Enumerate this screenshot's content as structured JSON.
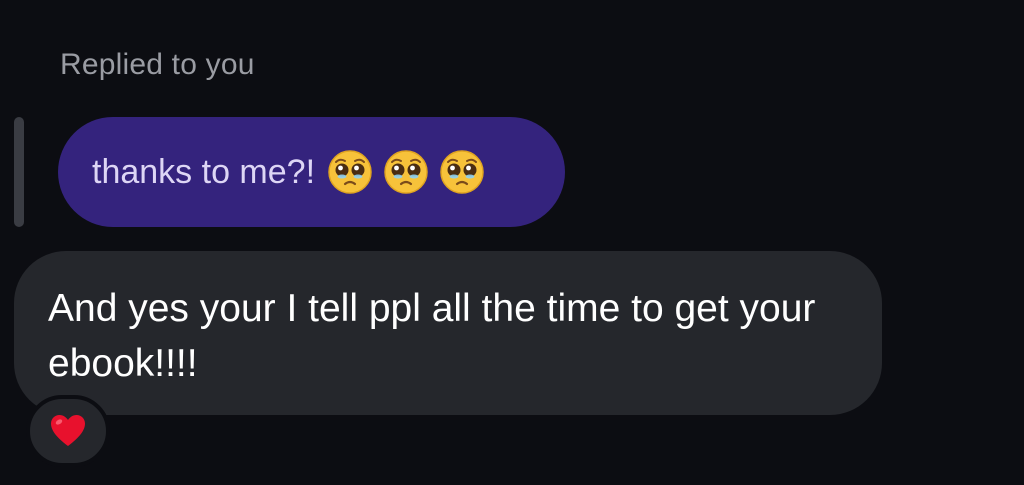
{
  "reply": {
    "caption": "Replied to you"
  },
  "quoted_message": {
    "text": "thanks to me?!",
    "emojis": [
      "pleading-face-emoji",
      "pleading-face-emoji",
      "pleading-face-emoji"
    ]
  },
  "message": {
    "text": "And yes your I tell ppl all the time to get your ebook!!!!"
  },
  "reaction": {
    "icon": "red-heart-icon"
  },
  "colors": {
    "background": "#0c0d12",
    "quoted_bubble": "#34237d",
    "message_bubble": "#25272c",
    "caption": "#9a9ca3"
  }
}
